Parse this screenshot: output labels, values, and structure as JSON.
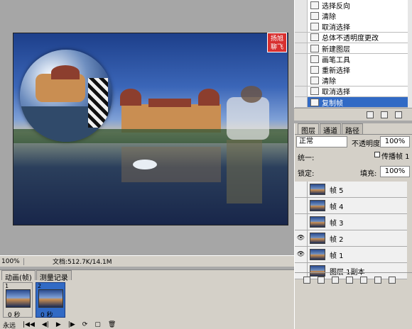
{
  "canvas": {
    "stamp_text": "扬旭\n聊飞"
  },
  "status": {
    "zoom": "100%",
    "doc": "文档:512.7K/14.1M"
  },
  "history": {
    "items": [
      {
        "label": "选择反向",
        "icon": "history-step-icon"
      },
      {
        "label": "清除",
        "icon": "history-step-icon"
      },
      {
        "label": "取消选择",
        "icon": "history-step-icon"
      },
      {
        "label": "总体不透明度更改",
        "icon": "history-step-icon"
      },
      {
        "label": "新建图层",
        "icon": "history-step-icon"
      },
      {
        "label": "画笔工具",
        "icon": "brush-icon"
      },
      {
        "label": "重新选择",
        "icon": "history-step-icon"
      },
      {
        "label": "清除",
        "icon": "history-step-icon"
      },
      {
        "label": "取消选择",
        "icon": "history-step-icon"
      },
      {
        "label": "复制帧",
        "icon": "history-step-icon",
        "selected": true
      }
    ]
  },
  "layers": {
    "tabs": [
      "图层",
      "通道",
      "路径"
    ],
    "blend_mode": "正常",
    "opacity_label": "不透明度:",
    "opacity_value": "100%",
    "unify_label": "统一:",
    "propagate_label": "传播帧 1",
    "lock_label": "锁定:",
    "fill_label": "填充:",
    "fill_value": "100%",
    "items": [
      {
        "name": "帧 5",
        "visible": false
      },
      {
        "name": "帧 4",
        "visible": false
      },
      {
        "name": "帧 3",
        "visible": false
      },
      {
        "name": "帧 2",
        "visible": true
      },
      {
        "name": "帧 1",
        "visible": true
      },
      {
        "name": "图层 1副本",
        "visible": false
      }
    ]
  },
  "animation": {
    "tabs": [
      "动画(帧)",
      "测量记录"
    ],
    "frames": [
      {
        "number": "1",
        "delay": "0 秒"
      },
      {
        "number": "2",
        "delay": "0 秒"
      }
    ],
    "loop": "永远"
  }
}
